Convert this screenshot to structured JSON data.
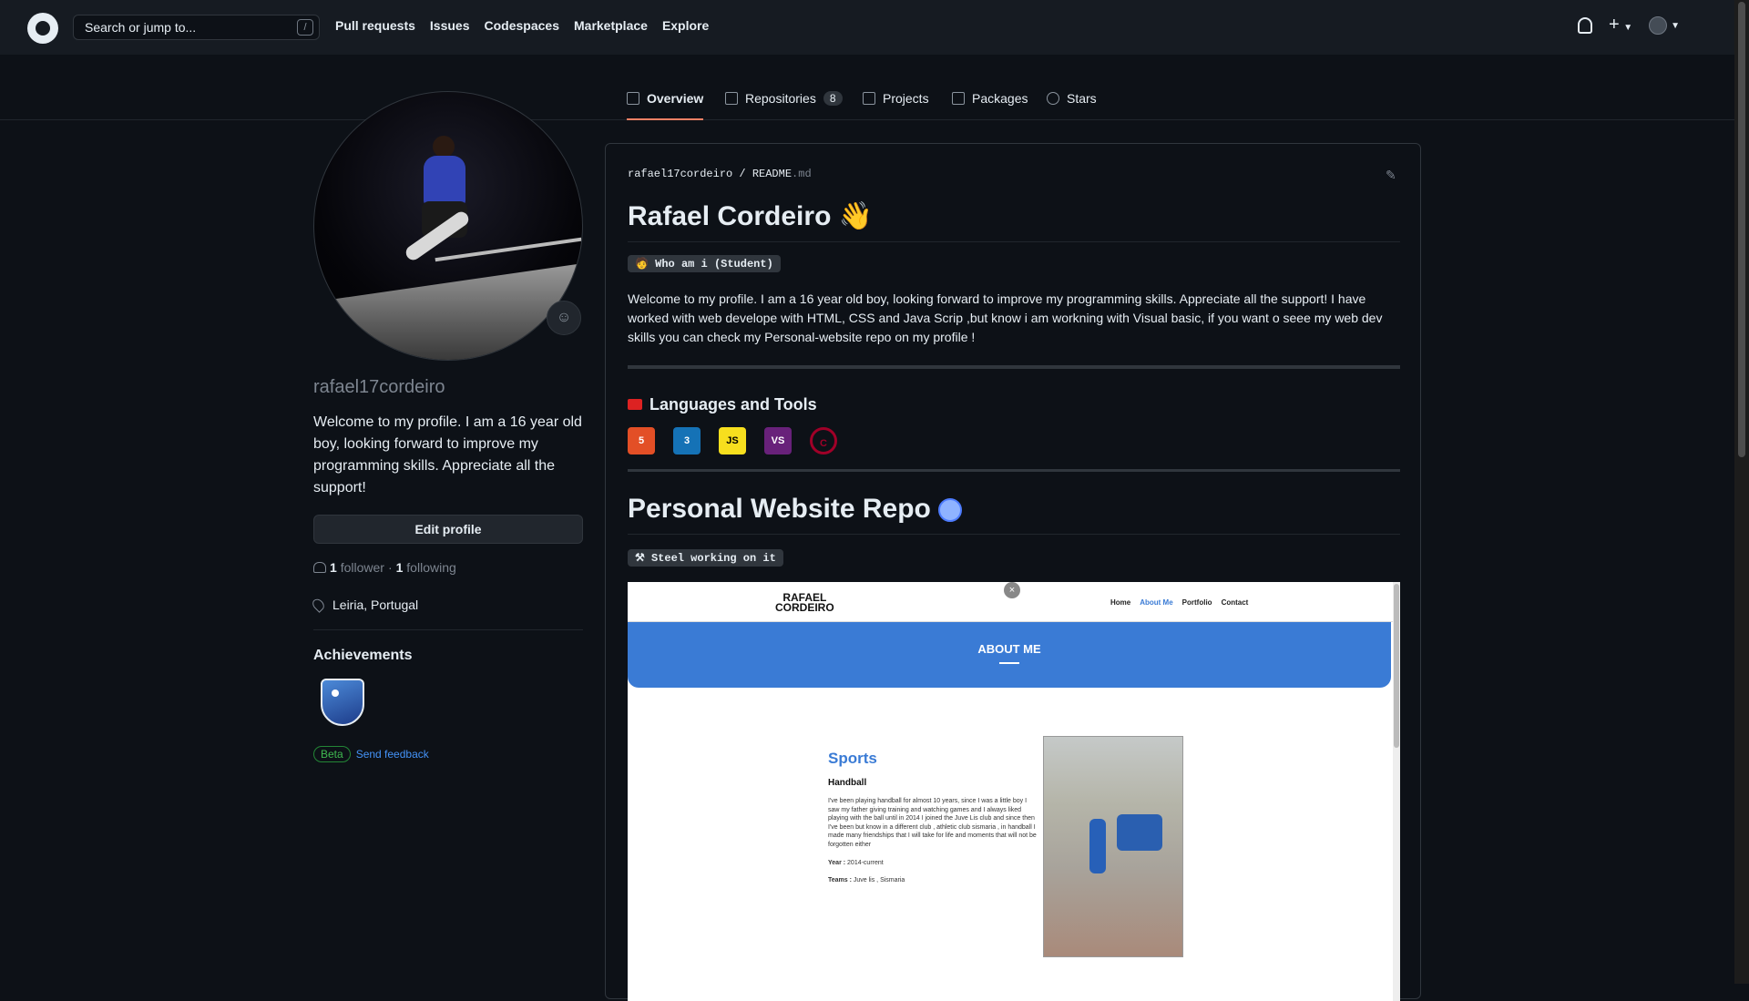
{
  "header": {
    "search_placeholder": "Search or jump to...",
    "search_shortcut": "/",
    "nav": [
      "Pull requests",
      "Issues",
      "Codespaces",
      "Marketplace",
      "Explore"
    ]
  },
  "tabs": [
    {
      "label": "Overview",
      "active": true,
      "icon": "book-icon"
    },
    {
      "label": "Repositories",
      "count": "8",
      "icon": "repo-icon"
    },
    {
      "label": "Projects",
      "icon": "table-icon"
    },
    {
      "label": "Packages",
      "icon": "package-icon"
    },
    {
      "label": "Stars",
      "icon": "star-icon"
    }
  ],
  "profile": {
    "username": "rafael17cordeiro",
    "bio": "Welcome to my profile. I am a 16 year old boy, looking forward to improve my programming skills. Appreciate all the support!",
    "edit_label": "Edit profile",
    "followers_count": "1",
    "followers_label": "follower",
    "dot": "·",
    "following_count": "1",
    "following_label": "following",
    "location": "Leiria, Portugal",
    "achievements_title": "Achievements",
    "beta_label": "Beta",
    "feedback_label": "Send feedback"
  },
  "readme": {
    "owner": "rafael17cordeiro",
    "sep": " / ",
    "file": "README",
    "ext": ".md",
    "title": "Rafael Cordeiro",
    "title_emoji": "👋",
    "who_badge": "🧑 Who am i (Student)",
    "intro": "Welcome to my profile. I am a 16 year old boy, looking forward to improve my programming skills. Appreciate all the support! I have worked with web develope with HTML, CSS and Java Scrip ,but know i am workning with Visual basic, if you want o seee my web dev skills you can check my Personal-website repo on my profile !",
    "tools_title": "Languages and Tools",
    "tools": [
      {
        "name": "html5-icon",
        "label": "5",
        "color": "#e34f26"
      },
      {
        "name": "css3-icon",
        "label": "3",
        "color": "#1572b6"
      },
      {
        "name": "javascript-icon",
        "label": "JS",
        "color": "#f7df1e"
      },
      {
        "name": "visual-studio-icon",
        "label": "VS",
        "color": "#68217a"
      },
      {
        "name": "c-icon",
        "label": "C",
        "color": "#a8b9cc"
      }
    ],
    "repo_title": "Personal Website Repo",
    "working_badge": "⚒ Steel working on it"
  },
  "preview": {
    "logo_line1": "RAFAEL",
    "logo_line2": "CORDEIRO",
    "close": "×",
    "nav": [
      "Home",
      "About Me",
      "Portfolio",
      "Contact"
    ],
    "banner": "ABOUT ME",
    "section": "Sports",
    "subsection": "Handball",
    "text": "I've been playing handball for almost 10 years, since I was a little boy I saw my father giving training and watching games and I always liked playing with the ball until in 2014 I joined the Juve Lis club and since then I've been but know in a different club , athletic club sismaria , in handball I made many friendships that I will take for life and moments that will not be forgotten either",
    "year_label": "Year :",
    "year_value": "2014-current",
    "teams_label": "Teams :",
    "teams_value": "Juve lis , Sismaria"
  }
}
